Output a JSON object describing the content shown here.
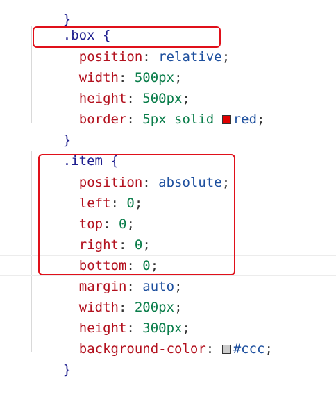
{
  "editor": {
    "top_fragment": "}",
    "box_rule": {
      "selector": ".box",
      "open": "{",
      "close": "}",
      "decls": [
        {
          "prop": "position",
          "value": "relative",
          "vtype": "kw"
        },
        {
          "prop": "width",
          "value": "500px",
          "vtype": "num"
        },
        {
          "prop": "height",
          "value": "500px",
          "vtype": "num"
        },
        {
          "prop": "border",
          "value": "5px solid",
          "vtype": "num",
          "swatch": "#e00000",
          "value2": "red"
        }
      ]
    },
    "item_rule": {
      "selector": ".item",
      "open": "{",
      "close": "}",
      "decls": [
        {
          "prop": "position",
          "value": "absolute",
          "vtype": "kw"
        },
        {
          "prop": "left",
          "value": "0",
          "vtype": "num"
        },
        {
          "prop": "top",
          "value": "0",
          "vtype": "num"
        },
        {
          "prop": "right",
          "value": "0",
          "vtype": "num"
        },
        {
          "prop": "bottom",
          "value": "0",
          "vtype": "num"
        },
        {
          "prop": "margin",
          "value": "auto",
          "vtype": "kw"
        },
        {
          "prop": "width",
          "value": "200px",
          "vtype": "num"
        },
        {
          "prop": "height",
          "value": "300px",
          "vtype": "num"
        },
        {
          "prop": "background-color",
          "value": "#ccc",
          "vtype": "kw",
          "swatch": "#cccccc"
        }
      ]
    },
    "colors": {
      "highlight": "#e0101a",
      "property": "#b3111e",
      "number": "#0a7d4a",
      "keyword": "#1d4f9e",
      "selector": "#1f1f8f"
    }
  }
}
